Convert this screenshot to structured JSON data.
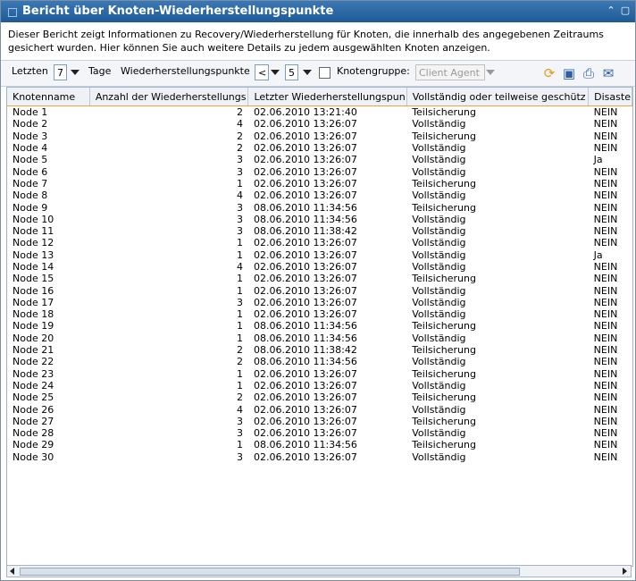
{
  "title": "Bericht über Knoten-Wiederherstellungspunkte",
  "description": "Dieser Bericht zeigt Informationen zu Recovery/Wiederherstellung für Knoten, die innerhalb des angegebenen Zeitraums gesichert wurden. Hier können Sie auch weitere Details zu jedem ausgewählten Knoten anzeigen.",
  "toolbar": {
    "letzten_label": "Letzten",
    "letzten_value": "7",
    "tage_label": "Tage",
    "wp_label": "Wiederherstellungspunkte",
    "wp_operator": "<",
    "wp_value": "5",
    "knotengruppe_label": "Knotengruppe:",
    "knotengruppe_value": "Client Agent"
  },
  "columns": [
    "Knotenname",
    "Anzahl der Wiederherstellungs",
    "Letzter Wiederherstellungspun",
    "Vollständig oder teilweise geschütz",
    "Disaste"
  ],
  "rows": [
    [
      "Node 1",
      "2",
      "02.06.2010 13:21:40",
      "Teilsicherung",
      "NEIN"
    ],
    [
      "Node 2",
      "4",
      "02.06.2010 13:26:07",
      "Vollständig",
      "NEIN"
    ],
    [
      "Node 3",
      "2",
      "02.06.2010 13:26:07",
      "Teilsicherung",
      "NEIN"
    ],
    [
      "Node 4",
      "2",
      "02.06.2010 13:26:07",
      "Vollständig",
      "NEIN"
    ],
    [
      "Node 5",
      "3",
      "02.06.2010 13:26:07",
      "Vollständig",
      "Ja"
    ],
    [
      "Node 6",
      "3",
      "02.06.2010 13:26:07",
      "Vollständig",
      "NEIN"
    ],
    [
      "Node 7",
      "1",
      "02.06.2010 13:26:07",
      "Teilsicherung",
      "NEIN"
    ],
    [
      "Node 8",
      "4",
      "02.06.2010 13:26:07",
      "Vollständig",
      "NEIN"
    ],
    [
      "Node 9",
      "3",
      "08.06.2010 11:34:56",
      "Teilsicherung",
      "NEIN"
    ],
    [
      "Node 10",
      "3",
      "08.06.2010 11:34:56",
      "Vollständig",
      "NEIN"
    ],
    [
      "Node 11",
      "3",
      "08.06.2010 11:38:42",
      "Vollständig",
      "NEIN"
    ],
    [
      "Node 12",
      "1",
      "02.06.2010 13:26:07",
      "Vollständig",
      "NEIN"
    ],
    [
      "Node 13",
      "1",
      "02.06.2010 13:26:07",
      "Vollständig",
      "Ja"
    ],
    [
      "Node 14",
      "4",
      "02.06.2010 13:26:07",
      "Vollständig",
      "NEIN"
    ],
    [
      "Node 15",
      "1",
      "02.06.2010 13:26:07",
      "Teilsicherung",
      "NEIN"
    ],
    [
      "Node 16",
      "1",
      "02.06.2010 13:26:07",
      "Vollständig",
      "NEIN"
    ],
    [
      "Node 17",
      "3",
      "02.06.2010 13:26:07",
      "Vollständig",
      "NEIN"
    ],
    [
      "Node 18",
      "1",
      "02.06.2010 13:26:07",
      "Vollständig",
      "NEIN"
    ],
    [
      "Node 19",
      "1",
      "08.06.2010 11:34:56",
      "Teilsicherung",
      "NEIN"
    ],
    [
      "Node 20",
      "1",
      "08.06.2010 11:34:56",
      "Vollständig",
      "NEIN"
    ],
    [
      "Node 21",
      "2",
      "08.06.2010 11:38:42",
      "Teilsicherung",
      "NEIN"
    ],
    [
      "Node 22",
      "2",
      "08.06.2010 11:34:56",
      "Vollständig",
      "NEIN"
    ],
    [
      "Node 23",
      "1",
      "02.06.2010 13:26:07",
      "Teilsicherung",
      "NEIN"
    ],
    [
      "Node 24",
      "1",
      "02.06.2010 13:26:07",
      "Vollständig",
      "NEIN"
    ],
    [
      "Node 25",
      "2",
      "02.06.2010 13:26:07",
      "Teilsicherung",
      "NEIN"
    ],
    [
      "Node 26",
      "4",
      "02.06.2010 13:26:07",
      "Vollständig",
      "NEIN"
    ],
    [
      "Node 27",
      "3",
      "02.06.2010 13:26:07",
      "Teilsicherung",
      "NEIN"
    ],
    [
      "Node 28",
      "3",
      "02.06.2010 13:26:07",
      "Vollständig",
      "NEIN"
    ],
    [
      "Node 29",
      "1",
      "08.06.2010 11:34:56",
      "Teilsicherung",
      "NEIN"
    ],
    [
      "Node 30",
      "3",
      "02.06.2010 13:26:07",
      "Vollständig",
      "NEIN"
    ]
  ],
  "icons": [
    "grip-icon",
    "collapse-icon",
    "maximize-icon",
    "dropdown-arrow-icon",
    "refresh-icon",
    "save-icon",
    "print-icon",
    "email-icon"
  ],
  "colors": {
    "titlebar": "#1e5a96",
    "header_underline": "#e7a83d"
  }
}
